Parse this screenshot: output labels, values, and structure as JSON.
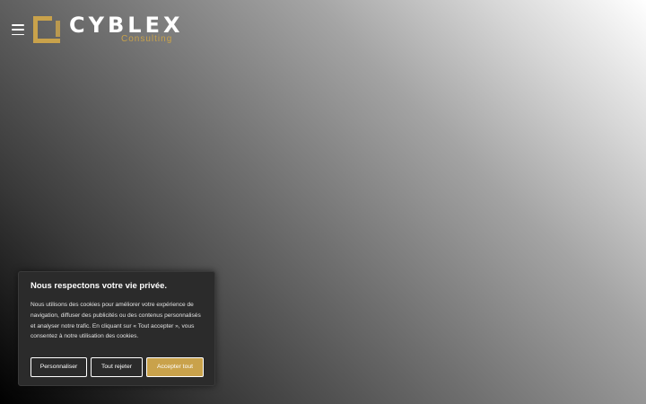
{
  "header": {
    "menu_icon": "hamburger-menu-icon",
    "logo": {
      "name": "CYBLEX",
      "subtitle": "Consulting",
      "mark_icon": "square-logo-icon",
      "brand_color": "#c9a24b",
      "text_color": "#ffffff"
    }
  },
  "cookie_banner": {
    "title": "Nous respectons votre vie privée.",
    "body": "Nous utilisons des cookies pour améliorer votre expérience de navigation, diffuser des publicités ou des contenus personnalisés et analyser notre trafic. En cliquant sur « Tout accepter », vous consentez à notre utilisation des cookies.",
    "buttons": {
      "personalize": "Personnaliser",
      "reject": "Tout rejeter",
      "accept": "Accepter tout"
    },
    "background_color": "#2b2b2b",
    "accent_color": "#c9a24b"
  }
}
